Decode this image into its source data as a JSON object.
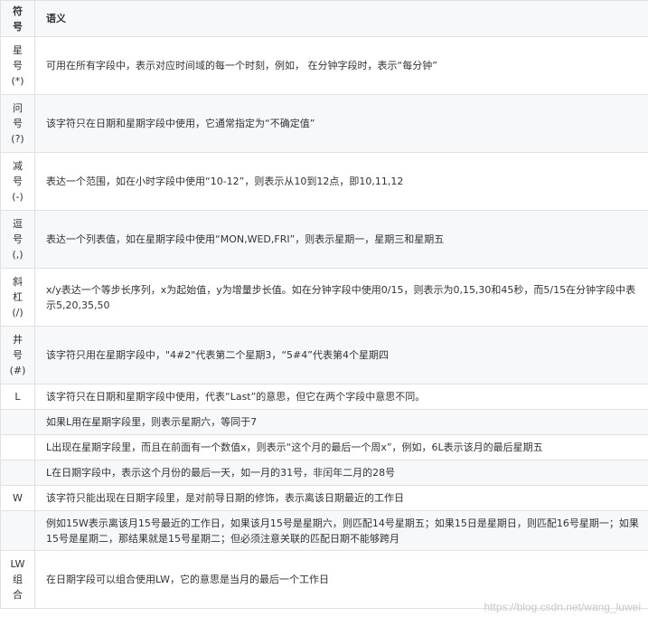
{
  "header": {
    "symbol": "符\n号",
    "meaning": "语义"
  },
  "rows": [
    {
      "symbol": "星\n号\n(*)",
      "meaning": "可用在所有字段中，表示对应时间域的每一个时刻，例如， 在分钟字段时，表示“每分钟”"
    },
    {
      "symbol": "问\n号\n(?)",
      "meaning": "该字符只在日期和星期字段中使用，它通常指定为“不确定值”"
    },
    {
      "symbol": "减\n号\n(-)",
      "meaning": "表达一个范围，如在小时字段中使用“10-12”，则表示从10到12点，即10,11,12"
    },
    {
      "symbol": "逗\n号\n(,)",
      "meaning": "表达一个列表值，如在星期字段中使用“MON,WED,FRI”，则表示星期一，星期三和星期五"
    },
    {
      "symbol": "斜\n杠\n(/)",
      "meaning": "x/y表达一个等步长序列，x为起始值，y为增量步长值。如在分钟字段中使用0/15，则表示为0,15,30和45秒，而5/15在分钟字段中表示5,20,35,50"
    },
    {
      "symbol": "井\n号\n(#)",
      "meaning": "该字符只用在星期字段中，\"4#2\"代表第二个星期3，“5#4”代表第4个星期四"
    },
    {
      "symbol": "L",
      "meaning": "该字符只在日期和星期字段中使用，代表“Last”的意思，但它在两个字段中意思不同。"
    },
    {
      "symbol": "",
      "meaning": "如果L用在星期字段里，则表示星期六，等同于7"
    },
    {
      "symbol": "",
      "meaning": "L出现在星期字段里，而且在前面有一个数值x，则表示“这个月的最后一个周x”，例如，6L表示该月的最后星期五"
    },
    {
      "symbol": "",
      "meaning": "L在日期字段中，表示这个月份的最后一天，如一月的31号，非闰年二月的28号"
    },
    {
      "symbol": "W",
      "meaning": "该字符只能出现在日期字段里，是对前导日期的修饰，表示离该日期最近的工作日"
    },
    {
      "symbol": "",
      "meaning": "例如15W表示离该月15号最近的工作日，如果该月15号是星期六，则匹配14号星期五；如果15日是星期日，则匹配16号星期一；如果15号是星期二，那结果就是15号星期二；但必须注意关联的匹配日期不能够跨月"
    },
    {
      "symbol": "LW\n组\n合",
      "meaning": "在日期字段可以组合使用LW，它的意思是当月的最后一个工作日"
    }
  ],
  "watermark": "https://blog.csdn.net/wang_luwei"
}
